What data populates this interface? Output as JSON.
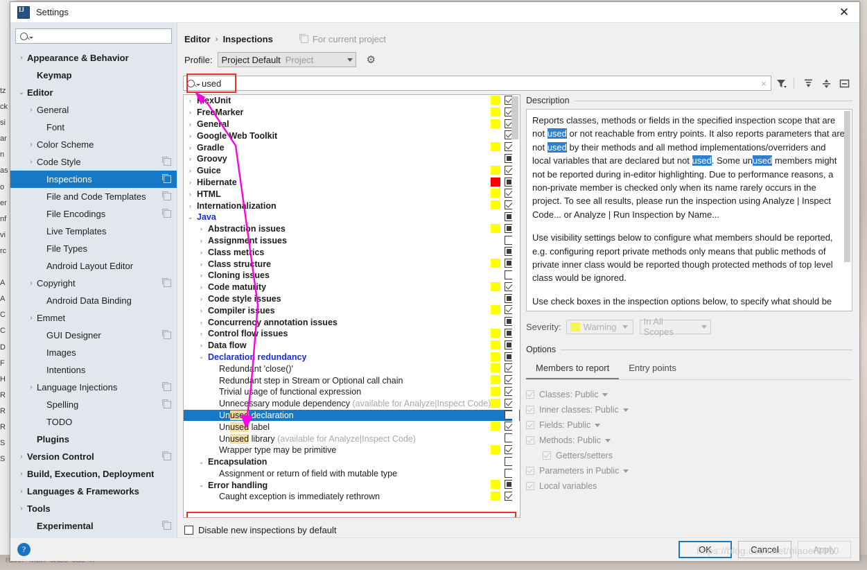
{
  "window": {
    "title": "Settings",
    "icon": "intellij-icon",
    "close": "✕"
  },
  "sidebar": {
    "search_placeholder": "",
    "search_value": "",
    "items": [
      {
        "label": "Appearance & Behavior",
        "arrow": "›",
        "bold": true,
        "indent": 0,
        "copy": false,
        "selected": false
      },
      {
        "label": "Keymap",
        "arrow": "",
        "bold": true,
        "indent": 1,
        "copy": false,
        "selected": false
      },
      {
        "label": "Editor",
        "arrow": "⌄",
        "bold": true,
        "indent": 0,
        "copy": false,
        "selected": false
      },
      {
        "label": "General",
        "arrow": "›",
        "bold": false,
        "indent": 1,
        "copy": false,
        "selected": false
      },
      {
        "label": "Font",
        "arrow": "",
        "bold": false,
        "indent": 2,
        "copy": false,
        "selected": false
      },
      {
        "label": "Color Scheme",
        "arrow": "›",
        "bold": false,
        "indent": 1,
        "copy": false,
        "selected": false
      },
      {
        "label": "Code Style",
        "arrow": "›",
        "bold": false,
        "indent": 1,
        "copy": true,
        "selected": false
      },
      {
        "label": "Inspections",
        "arrow": "",
        "bold": false,
        "indent": 2,
        "copy": true,
        "selected": true
      },
      {
        "label": "File and Code Templates",
        "arrow": "",
        "bold": false,
        "indent": 2,
        "copy": true,
        "selected": false
      },
      {
        "label": "File Encodings",
        "arrow": "",
        "bold": false,
        "indent": 2,
        "copy": true,
        "selected": false
      },
      {
        "label": "Live Templates",
        "arrow": "",
        "bold": false,
        "indent": 2,
        "copy": false,
        "selected": false
      },
      {
        "label": "File Types",
        "arrow": "",
        "bold": false,
        "indent": 2,
        "copy": false,
        "selected": false
      },
      {
        "label": "Android Layout Editor",
        "arrow": "",
        "bold": false,
        "indent": 2,
        "copy": false,
        "selected": false
      },
      {
        "label": "Copyright",
        "arrow": "›",
        "bold": false,
        "indent": 1,
        "copy": true,
        "selected": false
      },
      {
        "label": "Android Data Binding",
        "arrow": "",
        "bold": false,
        "indent": 2,
        "copy": false,
        "selected": false
      },
      {
        "label": "Emmet",
        "arrow": "›",
        "bold": false,
        "indent": 1,
        "copy": false,
        "selected": false
      },
      {
        "label": "GUI Designer",
        "arrow": "",
        "bold": false,
        "indent": 2,
        "copy": true,
        "selected": false
      },
      {
        "label": "Images",
        "arrow": "",
        "bold": false,
        "indent": 2,
        "copy": false,
        "selected": false
      },
      {
        "label": "Intentions",
        "arrow": "",
        "bold": false,
        "indent": 2,
        "copy": false,
        "selected": false
      },
      {
        "label": "Language Injections",
        "arrow": "›",
        "bold": false,
        "indent": 1,
        "copy": true,
        "selected": false
      },
      {
        "label": "Spelling",
        "arrow": "",
        "bold": false,
        "indent": 2,
        "copy": true,
        "selected": false
      },
      {
        "label": "TODO",
        "arrow": "",
        "bold": false,
        "indent": 2,
        "copy": false,
        "selected": false
      },
      {
        "label": "Plugins",
        "arrow": "",
        "bold": true,
        "indent": 1,
        "copy": false,
        "selected": false
      },
      {
        "label": "Version Control",
        "arrow": "›",
        "bold": true,
        "indent": 0,
        "copy": true,
        "selected": false
      },
      {
        "label": "Build, Execution, Deployment",
        "arrow": "›",
        "bold": true,
        "indent": 0,
        "copy": false,
        "selected": false
      },
      {
        "label": "Languages & Frameworks",
        "arrow": "›",
        "bold": true,
        "indent": 0,
        "copy": false,
        "selected": false
      },
      {
        "label": "Tools",
        "arrow": "›",
        "bold": true,
        "indent": 0,
        "copy": false,
        "selected": false
      },
      {
        "label": "Experimental",
        "arrow": "",
        "bold": true,
        "indent": 1,
        "copy": true,
        "selected": false
      }
    ]
  },
  "header": {
    "breadcrumb_1": "Editor",
    "breadcrumb_sep": "›",
    "breadcrumb_2": "Inspections",
    "scope_label": "For current project",
    "profile_label": "Profile:",
    "profile_value": "Project Default",
    "profile_sub": "Project",
    "gear_icon": "gear-icon"
  },
  "filter": {
    "value": "used",
    "placeholder": "",
    "clear_icon": "×",
    "icons": [
      "filter-icon",
      "expand-all-icon",
      "collapse-all-icon",
      "reset-icon"
    ]
  },
  "tree": {
    "rows": [
      {
        "label": "FlexUnit",
        "indent": 0,
        "arrow": "›",
        "style": "bold",
        "sev": "#ffff00",
        "cb": "check",
        "note": ""
      },
      {
        "label": "FreeMarker",
        "indent": 0,
        "arrow": "›",
        "style": "bold",
        "sev": "#ffff00",
        "cb": "check",
        "note": ""
      },
      {
        "label": "General",
        "indent": 0,
        "arrow": "›",
        "style": "bold",
        "sev": "#ffff00",
        "cb": "check",
        "note": ""
      },
      {
        "label": "Google Web Toolkit",
        "indent": 0,
        "arrow": "›",
        "style": "bold",
        "sev": "",
        "cb": "check",
        "note": ""
      },
      {
        "label": "Gradle",
        "indent": 0,
        "arrow": "›",
        "style": "bold",
        "sev": "#ffff00",
        "cb": "check",
        "note": ""
      },
      {
        "label": "Groovy",
        "indent": 0,
        "arrow": "›",
        "style": "bold",
        "sev": "",
        "cb": "square",
        "note": ""
      },
      {
        "label": "Guice",
        "indent": 0,
        "arrow": "›",
        "style": "bold",
        "sev": "#ffff00",
        "cb": "check",
        "note": ""
      },
      {
        "label": "Hibernate",
        "indent": 0,
        "arrow": "›",
        "style": "bold",
        "sev": "#ff0000",
        "cb": "square",
        "note": ""
      },
      {
        "label": "HTML",
        "indent": 0,
        "arrow": "›",
        "style": "bold",
        "sev": "#ffff00",
        "cb": "check",
        "note": ""
      },
      {
        "label": "Internationalization",
        "indent": 0,
        "arrow": "›",
        "style": "bold",
        "sev": "#ffff00",
        "cb": "check",
        "note": ""
      },
      {
        "label": "Java",
        "indent": 0,
        "arrow": "⌄",
        "style": "blue",
        "sev": "",
        "cb": "square",
        "note": ""
      },
      {
        "label": "Abstraction issues",
        "indent": 1,
        "arrow": "›",
        "style": "bold",
        "sev": "#ffff00",
        "cb": "square",
        "note": ""
      },
      {
        "label": "Assignment issues",
        "indent": 1,
        "arrow": "›",
        "style": "bold",
        "sev": "",
        "cb": "empty",
        "note": ""
      },
      {
        "label": "Class metrics",
        "indent": 1,
        "arrow": "›",
        "style": "bold",
        "sev": "",
        "cb": "square",
        "note": ""
      },
      {
        "label": "Class structure",
        "indent": 1,
        "arrow": "›",
        "style": "bold",
        "sev": "#ffff00",
        "cb": "square",
        "note": ""
      },
      {
        "label": "Cloning issues",
        "indent": 1,
        "arrow": "›",
        "style": "bold",
        "sev": "",
        "cb": "empty",
        "note": ""
      },
      {
        "label": "Code maturity",
        "indent": 1,
        "arrow": "›",
        "style": "bold",
        "sev": "#ffff00",
        "cb": "check",
        "note": ""
      },
      {
        "label": "Code style issues",
        "indent": 1,
        "arrow": "›",
        "style": "bold",
        "sev": "",
        "cb": "square",
        "note": ""
      },
      {
        "label": "Compiler issues",
        "indent": 1,
        "arrow": "›",
        "style": "bold",
        "sev": "#ffff00",
        "cb": "check",
        "note": ""
      },
      {
        "label": "Concurrency annotation issues",
        "indent": 1,
        "arrow": "›",
        "style": "bold",
        "sev": "",
        "cb": "square",
        "note": ""
      },
      {
        "label": "Control flow issues",
        "indent": 1,
        "arrow": "›",
        "style": "bold",
        "sev": "#ffff00",
        "cb": "square",
        "note": ""
      },
      {
        "label": "Data flow",
        "indent": 1,
        "arrow": "›",
        "style": "bold",
        "sev": "#ffff00",
        "cb": "square",
        "note": ""
      },
      {
        "label": "Declaration redundancy",
        "indent": 1,
        "arrow": "⌄",
        "style": "blue",
        "sev": "#ffff00",
        "cb": "square",
        "note": ""
      },
      {
        "label": "Redundant 'close()'",
        "indent": 2,
        "arrow": "",
        "style": "plain",
        "sev": "#ffff00",
        "cb": "check",
        "note": ""
      },
      {
        "label": "Redundant step in Stream or Optional call chain",
        "indent": 2,
        "arrow": "",
        "style": "plain",
        "sev": "#ffff00",
        "cb": "check",
        "note": ""
      },
      {
        "label": "Trivial usage of functional expression",
        "indent": 2,
        "arrow": "",
        "style": "plain",
        "sev": "#ffff00",
        "cb": "check",
        "note": ""
      },
      {
        "label": "Unnecessary module dependency",
        "indent": 2,
        "arrow": "",
        "style": "plain",
        "sev": "#ffff00",
        "cb": "check",
        "note": " (available for Analyze|Inspect Code)"
      },
      {
        "label": "Unused declaration",
        "indent": 2,
        "arrow": "",
        "style": "selected",
        "sev": "",
        "cb": "empty",
        "note": "",
        "highlight": "used"
      },
      {
        "label": "Unused label",
        "indent": 2,
        "arrow": "",
        "style": "plain",
        "sev": "#ffff00",
        "cb": "check",
        "note": "",
        "highlight": "used"
      },
      {
        "label": "Unused library",
        "indent": 2,
        "arrow": "",
        "style": "plain",
        "sev": "",
        "cb": "empty",
        "note": " (available for Analyze|Inspect Code)",
        "highlight": "used"
      },
      {
        "label": "Wrapper type may be primitive",
        "indent": 2,
        "arrow": "",
        "style": "plain",
        "sev": "#ffff00",
        "cb": "check",
        "note": ""
      },
      {
        "label": "Encapsulation",
        "indent": 1,
        "arrow": "⌄",
        "style": "bold",
        "sev": "",
        "cb": "empty",
        "note": ""
      },
      {
        "label": "Assignment or return of field with mutable type",
        "indent": 2,
        "arrow": "",
        "style": "plain",
        "sev": "",
        "cb": "empty",
        "note": ""
      },
      {
        "label": "Error handling",
        "indent": 1,
        "arrow": "⌄",
        "style": "bold",
        "sev": "#ffff00",
        "cb": "square",
        "note": ""
      },
      {
        "label": "Caught exception is immediately rethrown",
        "indent": 2,
        "arrow": "",
        "style": "plain",
        "sev": "#ffff00",
        "cb": "check",
        "note": ""
      }
    ]
  },
  "description": {
    "title": "Description",
    "paragraph_1_a": "Reports classes, methods or fields in the specified inspection scope that are not ",
    "hl_1": "used",
    "paragraph_1_b": " or not reachable from entry points. It also reports parameters that are not ",
    "hl_2": "used",
    "paragraph_1_c": " by their methods and all method implementations/overriders and local variables that are declared but not ",
    "hl_3": "used",
    "paragraph_1_d": ". Some un",
    "hl_4": "used",
    "paragraph_1_e": " members might not be reported during in-editor highlighting. Due to performance reasons, a non-private member is checked only when its name rarely occurs in the project. To see all results, please run the inspection using Analyze | Inspect Code... or Analyze | Run Inspection by Name...",
    "paragraph_2": "Use visibility settings below to configure what members should be reported, e.g. configuring report private methods only means that public methods of private inner class would be reported though protected methods of top level class would be ignored.",
    "paragraph_3": "Use check boxes in the inspection options below, to specify what should be"
  },
  "severity": {
    "label": "Severity:",
    "value": "Warning",
    "swatch": "#f5f35a",
    "scope_value": "In All Scopes"
  },
  "options": {
    "title": "Options",
    "tabs": [
      {
        "label": "Members to report",
        "active": true
      },
      {
        "label": "Entry points",
        "active": false
      }
    ],
    "items": [
      {
        "label": "Classes: Public",
        "caret": true,
        "indent": false
      },
      {
        "label": "Inner classes: Public",
        "caret": true,
        "indent": false
      },
      {
        "label": "Fields: Public",
        "caret": true,
        "indent": false
      },
      {
        "label": "Methods: Public",
        "caret": true,
        "indent": false
      },
      {
        "label": "Getters/setters",
        "caret": false,
        "indent": true
      },
      {
        "label": "Parameters in Public",
        "caret": true,
        "indent": false
      },
      {
        "label": "Local variables",
        "caret": false,
        "indent": false
      }
    ]
  },
  "footer": {
    "disable_label": "Disable new inspections by default",
    "help_icon": "?",
    "ok": "OK",
    "cancel": "Cancel",
    "apply": "Apply"
  },
  "annotations": {
    "arrow_color": "#ff00e0",
    "box_color": "#e8332a",
    "watermark": "https://blog.csdn.net/niaoer2010"
  },
  "background": {
    "left_strip": "tz\nck\nsi\nar\nn\nas\no\ner\nnf\nvi\nrc\n\nA\nA\nC\nC\nD\nF\nH\nR\nR\nR\nS\nS",
    "bottom_strip": "ruser  Mbh  cnbs  cus  n"
  }
}
